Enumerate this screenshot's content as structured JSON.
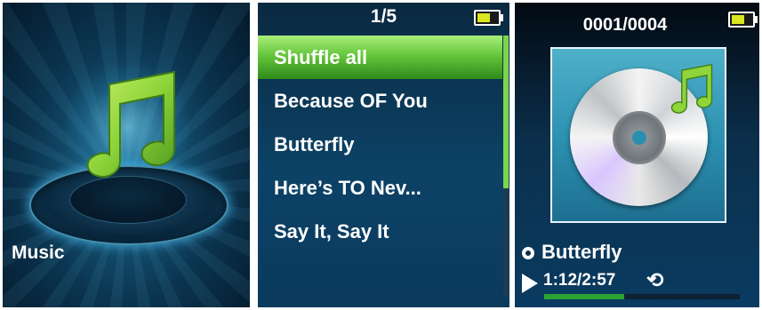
{
  "screens": {
    "home": {
      "label": "Music",
      "icon": "music-note-icon",
      "accent": "#8ed43a"
    },
    "list": {
      "counter": "1/5",
      "items": [
        {
          "label": "Shuffle all",
          "selected": true
        },
        {
          "label": "Because OF You",
          "selected": false
        },
        {
          "label": "Butterfly",
          "selected": false
        },
        {
          "label": "Here’s TO Nev...",
          "selected": false
        },
        {
          "label": "Say It, Say It",
          "selected": false
        }
      ],
      "highlight_color": "#66c63c",
      "battery_level": 0.6
    },
    "player": {
      "counter": "0001/0004",
      "song_title": "Butterfly",
      "time": "1:12/2:57",
      "repeat_icon": "⟲",
      "progress": 0.41,
      "progress_color": "#2ca233",
      "battery_level": 0.6
    }
  }
}
